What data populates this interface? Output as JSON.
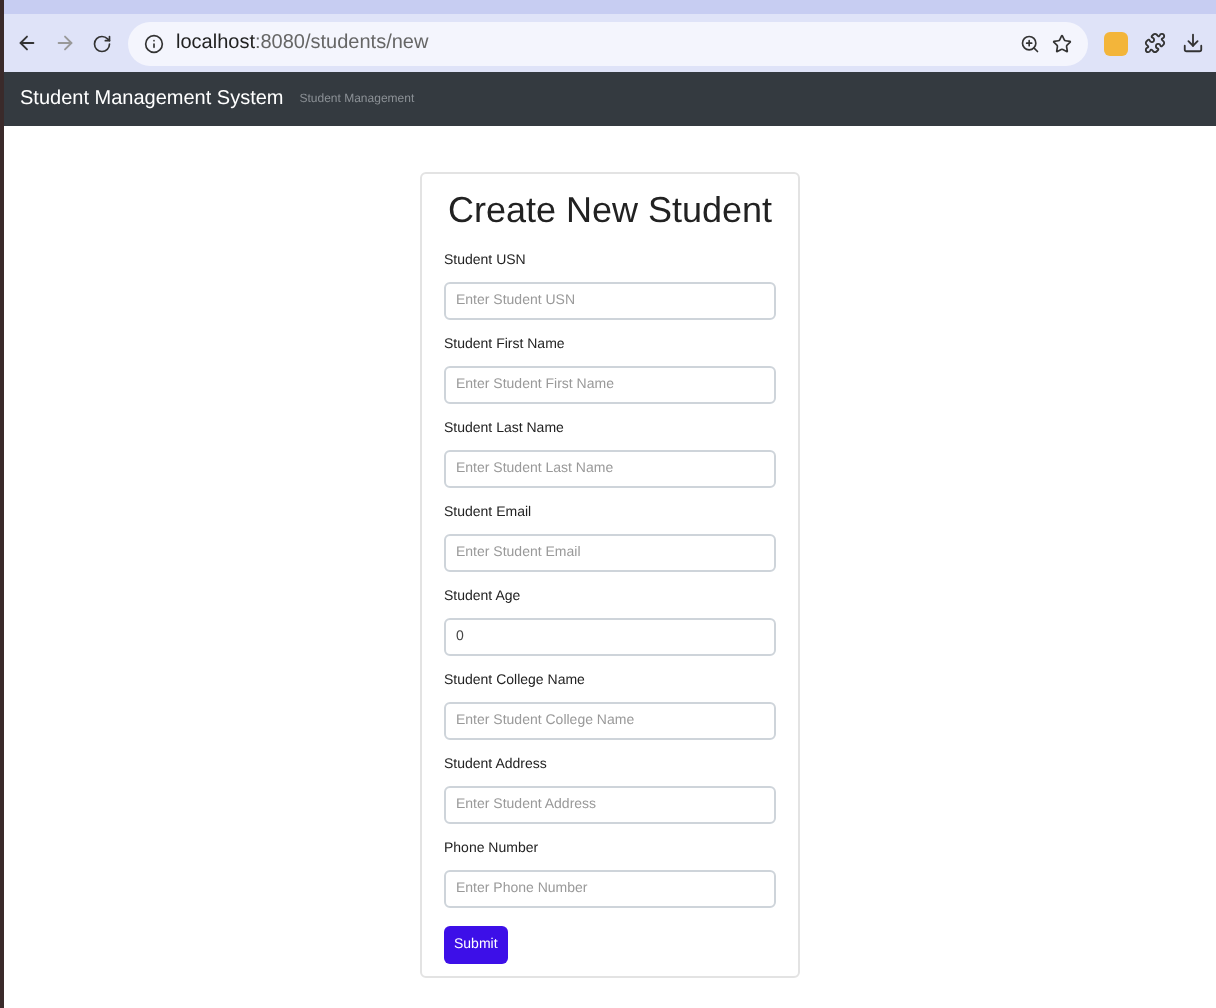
{
  "browser": {
    "url_host": "localhost",
    "url_path": ":8080/students/new"
  },
  "navbar": {
    "brand": "Student Management System",
    "link": "Student Management"
  },
  "form": {
    "title": "Create New Student",
    "fields": [
      {
        "label": "Student USN",
        "placeholder": "Enter Student USN"
      },
      {
        "label": "Student First Name",
        "placeholder": "Enter Student First Name"
      },
      {
        "label": "Student Last Name",
        "placeholder": "Enter Student Last Name"
      },
      {
        "label": "Student Email",
        "placeholder": "Enter Student Email"
      },
      {
        "label": "Student Age",
        "value": "0"
      },
      {
        "label": "Student College Name",
        "placeholder": "Enter Student College Name"
      },
      {
        "label": "Student Address",
        "placeholder": "Enter Student Address"
      },
      {
        "label": "Phone Number",
        "placeholder": "Enter Phone Number"
      }
    ],
    "submit": "Submit"
  }
}
